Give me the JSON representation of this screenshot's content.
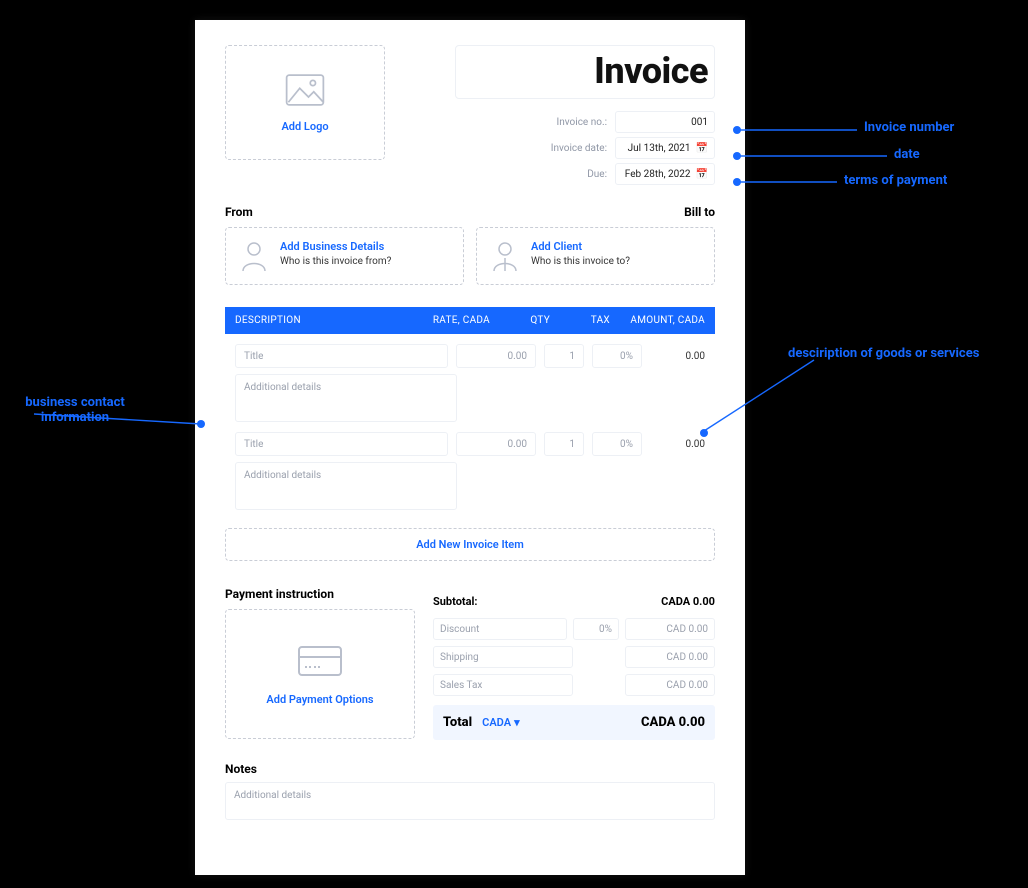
{
  "title": "Invoice",
  "logo": {
    "link": "Add Logo"
  },
  "meta": {
    "no_label": "Invoice no.:",
    "no_value": "001",
    "date_label": "Invoice date:",
    "date_value": "Jul 13th, 2021",
    "due_label": "Due:",
    "due_value": "Feb 28th, 2022"
  },
  "from_label": "From",
  "billto_label": "Bill to",
  "from_box": {
    "link": "Add Business Details",
    "sub": "Who is this invoice from?"
  },
  "to_box": {
    "link": "Add Client",
    "sub": "Who is this invoice to?"
  },
  "columns": {
    "desc": "DESCRIPTION",
    "rate": "RATE, CADA",
    "qty": "QTY",
    "tax": "TAX",
    "amount": "AMOUNT, CADA"
  },
  "item_placeholders": {
    "title": "Title",
    "details": "Additional details",
    "rate": "0.00",
    "qty": "1",
    "tax": "0%",
    "amount": "0.00"
  },
  "add_item": "Add New Invoice Item",
  "payment": {
    "heading": "Payment instruction",
    "link": "Add Payment Options"
  },
  "totals": {
    "subtotal_label": "Subtotal:",
    "subtotal_value": "CADA 0.00",
    "discount_label": "Discount",
    "discount_pct": "0%",
    "cad_zero": "CAD 0.00",
    "shipping_label": "Shipping",
    "salestax_label": "Sales Tax",
    "total_label": "Total",
    "currency": "CADA",
    "total_value": "CADA 0.00"
  },
  "notes": {
    "heading": "Notes",
    "placeholder": "Additional details"
  },
  "annotations": {
    "invoice_number": "Invoice number",
    "date": "date",
    "terms": "terms of payment",
    "goods": "desciription of goods or services",
    "biz": "business contact information"
  }
}
